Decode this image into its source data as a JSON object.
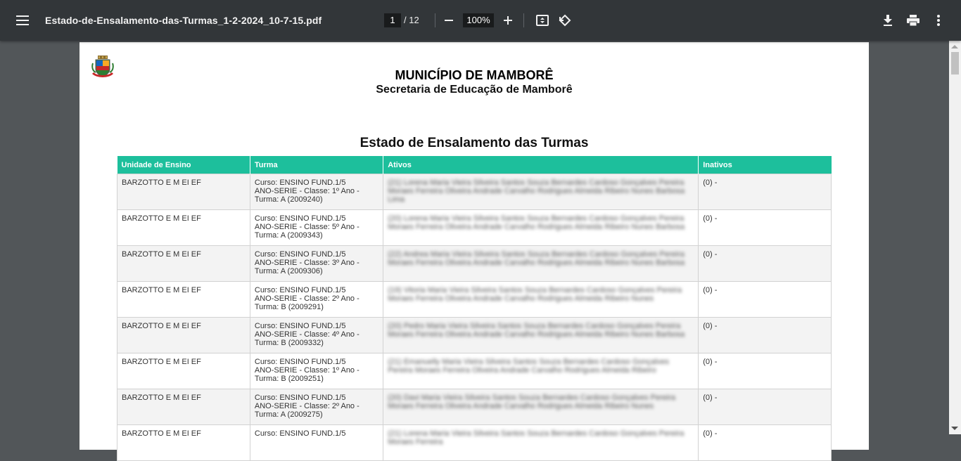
{
  "toolbar": {
    "title": "Estado-de-Ensalamento-das-Turmas_1-2-2024_10-7-15.pdf",
    "page_current": "1",
    "page_total": "/ 12",
    "zoom": "100%"
  },
  "document": {
    "heading": "MUNICÍPIO DE MAMBORÊ",
    "subheading": "Secretaria de Educação de Mamborê",
    "report_title": "Estado de Ensalamento das Turmas",
    "columns": [
      "Unidade de Ensino",
      "Turma",
      "Ativos",
      "Inativos"
    ],
    "rows": [
      {
        "unidade": "BARZOTTO E M EI EF",
        "turma_1": "Curso: ENSINO FUND.1/5",
        "turma_2": "ANO-SERIE - Classe: 1º Ano -",
        "turma_3": "Turma: A (2009240)",
        "ativos": "(21) Lorena Maria Vieira Silveira Santos Souza Bernardes Cardoso Gonçalves Pereira Moraes Ferreira Oliveira Andrade Carvalho Rodrigues Almeida Ribeiro Nunes Barbosa Lima",
        "inativos": "(0) -"
      },
      {
        "unidade": "BARZOTTO E M EI EF",
        "turma_1": "Curso: ENSINO FUND.1/5",
        "turma_2": "ANO-SERIE - Classe: 5º Ano -",
        "turma_3": "Turma: A (2009343)",
        "ativos": "(20) Lorena Maria Vieira Silveira Santos Souza Bernardes Cardoso Gonçalves Pereira Moraes Ferreira Oliveira Andrade Carvalho Rodrigues Almeida Ribeiro Nunes Barbosa",
        "inativos": "(0) -"
      },
      {
        "unidade": "BARZOTTO E M EI EF",
        "turma_1": "Curso: ENSINO FUND.1/5",
        "turma_2": "ANO-SERIE - Classe: 3º Ano -",
        "turma_3": "Turma: A (2009306)",
        "ativos": "(22) Andrea Maria Vieira Silveira Santos Souza Bernardes Cardoso Gonçalves Pereira Moraes Ferreira Oliveira Andrade Carvalho Rodrigues Almeida Ribeiro Nunes Barbosa",
        "inativos": "(0) -"
      },
      {
        "unidade": "BARZOTTO E M EI EF",
        "turma_1": "Curso: ENSINO FUND.1/5",
        "turma_2": "ANO-SERIE - Classe: 2º Ano -",
        "turma_3": "Turma: B (2009291)",
        "ativos": "(19) Vitoria Maria Vieira Silveira Santos Souza Bernardes Cardoso Gonçalves Pereira Moraes Ferreira Oliveira Andrade Carvalho Rodrigues Almeida Ribeiro Nunes",
        "inativos": "(0) -"
      },
      {
        "unidade": "BARZOTTO E M EI EF",
        "turma_1": "Curso: ENSINO FUND.1/5",
        "turma_2": "ANO-SERIE - Classe: 4º Ano -",
        "turma_3": "Turma: B (2009332)",
        "ativos": "(20) Pedro Maria Vieira Silveira Santos Souza Bernardes Cardoso Gonçalves Pereira Moraes Ferreira Oliveira Andrade Carvalho Rodrigues Almeida Ribeiro Nunes Barbosa",
        "inativos": "(0) -"
      },
      {
        "unidade": "BARZOTTO E M EI EF",
        "turma_1": "Curso: ENSINO FUND.1/5",
        "turma_2": "ANO-SERIE - Classe: 1º Ano -",
        "turma_3": "Turma: B (2009251)",
        "ativos": "(21) Emanuelly Maria Vieira Silveira Santos Souza Bernardes Cardoso Gonçalves Pereira Moraes Ferreira Oliveira Andrade Carvalho Rodrigues Almeida Ribeiro",
        "inativos": "(0) -"
      },
      {
        "unidade": "BARZOTTO E M EI EF",
        "turma_1": "Curso: ENSINO FUND.1/5",
        "turma_2": "ANO-SERIE - Classe: 2º Ano -",
        "turma_3": "Turma: A (2009275)",
        "ativos": "(20) Davi Maria Vieira Silveira Santos Souza Bernardes Cardoso Gonçalves Pereira Moraes Ferreira Oliveira Andrade Carvalho Rodrigues Almeida Ribeiro Nunes",
        "inativos": "(0) -"
      },
      {
        "unidade": "BARZOTTO E M EI EF",
        "turma_1": "Curso: ENSINO FUND.1/5",
        "turma_2": "",
        "turma_3": "",
        "ativos": "(21) Lorena Maria Vieira Silveira Santos Souza Bernardes Cardoso Gonçalves Pereira Moraes Ferreira",
        "inativos": "(0) -"
      }
    ]
  }
}
